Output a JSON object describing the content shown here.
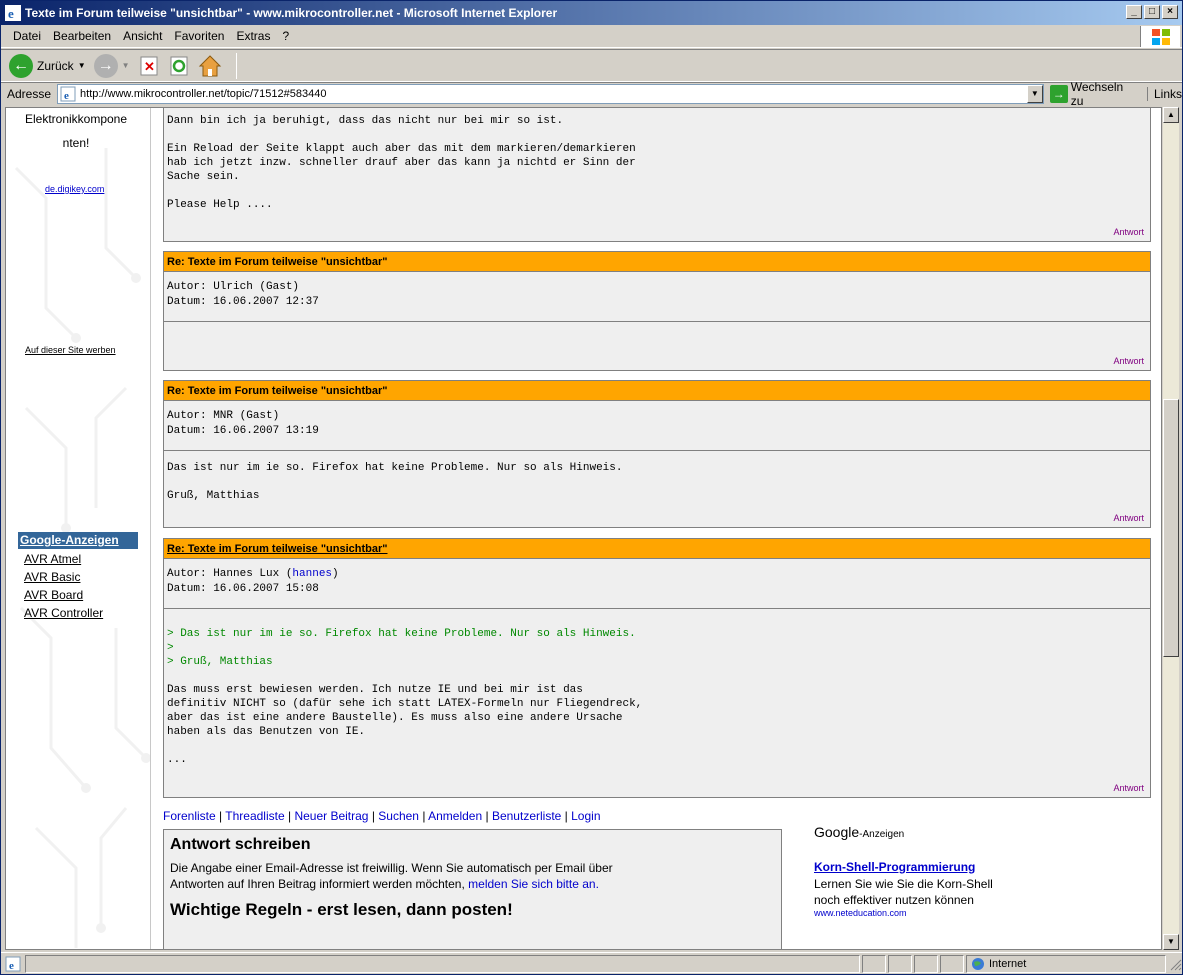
{
  "window": {
    "title": "Texte im Forum teilweise \"unsichtbar\" - www.mikrocontroller.net - Microsoft Internet Explorer"
  },
  "menu": [
    "Datei",
    "Bearbeiten",
    "Ansicht",
    "Favoriten",
    "Extras",
    "?"
  ],
  "toolbar": {
    "back_label": "Zurück"
  },
  "address": {
    "label": "Adresse",
    "url": "http://www.mikrocontroller.net/topic/71512#583440",
    "go_label": "Wechseln zu",
    "links_label": "Links"
  },
  "sidebar": {
    "ad_text_1": "Elektronikkompone",
    "ad_text_2": "nten!",
    "ad_url": "de.digikey.com",
    "advertise": "Auf dieser Site werben",
    "google_ads_title": "Google-Anzeigen",
    "google_ads": [
      "AVR Atmel",
      "AVR Basic",
      "AVR Board",
      "AVR Controller"
    ]
  },
  "posts": {
    "first_body": "Dann bin ich ja beruhigt, dass das nicht nur bei mir so ist.\n\nEin Reload der Seite klappt auch aber das mit dem markieren/demarkieren\nhab ich jetzt inzw. schneller drauf aber das kann ja nichtd er Sinn der\nSache sein.\n\nPlease Help ....",
    "reply_label": "Antwort",
    "p2": {
      "title": "Re: Texte im Forum teilweise \"unsichtbar\"",
      "meta": "Autor: Ulrich (Gast)\nDatum: 16.06.2007 12:37"
    },
    "p3": {
      "title": "Re: Texte im Forum teilweise \"unsichtbar\"",
      "meta": "Autor: MNR (Gast)\nDatum: 16.06.2007 13:19",
      "body": "Das ist nur im ie so. Firefox hat keine Probleme. Nur so als Hinweis.\n\nGruß, Matthias"
    },
    "p4": {
      "title": "Re: Texte im Forum teilweise \"unsichtbar\"",
      "meta_prefix": "Autor: Hannes Lux (",
      "meta_user": "hannes",
      "meta_suffix": ")",
      "date": "Datum: 16.06.2007 15:08",
      "quote": "> Das ist nur im ie so. Firefox hat keine Probleme. Nur so als Hinweis.\n>\n> Gruß, Matthias",
      "body": "Das muss erst bewiesen werden. Ich nutze IE und bei mir ist das\ndefinitiv NICHT so (dafür sehe ich statt LATEX-Formeln nur Fliegendreck,\naber das ist eine andere Baustelle). Es muss also eine andere Ursache\nhaben als das Benutzen von IE.\n\n..."
    }
  },
  "footer": {
    "links": [
      "Forenliste",
      "Threadliste",
      "Neuer Beitrag",
      "Suchen",
      "Anmelden",
      "Benutzerliste",
      "Login"
    ]
  },
  "answer": {
    "title": "Antwort schreiben",
    "text": "Die Angabe einer Email-Adresse ist freiwillig. Wenn Sie automatisch per Email über Antworten auf Ihren Beitrag informiert werden möchten, ",
    "link": "melden Sie sich bitte an.",
    "rules": "Wichtige Regeln - erst lesen, dann posten!"
  },
  "gads": {
    "logo": "Google",
    "logo_suffix": "-Anzeigen",
    "ad_title": "Korn-Shell-Programmierung",
    "ad_text": "Lernen Sie wie Sie die Korn-Shell noch effektiver nutzen können",
    "ad_url": "www.neteducation.com"
  },
  "status": {
    "zone": "Internet"
  }
}
